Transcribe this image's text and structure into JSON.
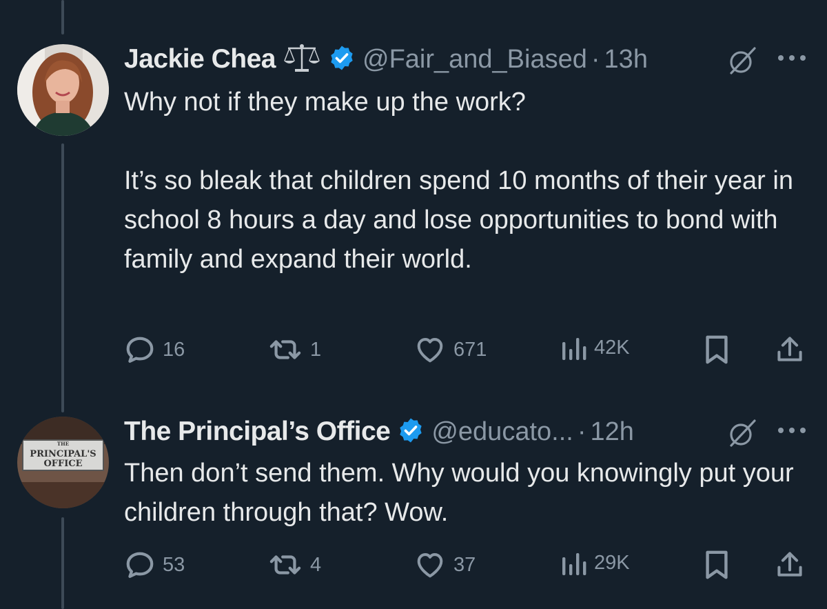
{
  "tweets": [
    {
      "display_name": "Jackie Chea",
      "handle": "@Fair_and_Biased",
      "separator": "·",
      "time": "13h",
      "text": "Why not if they make up the work?\n\nIt’s so bleak that children spend 10 months of their year in school 8 hours a day and lose opportunities to bond with family and expand their world.",
      "replies": "16",
      "reposts": "1",
      "likes": "671",
      "views": "42K",
      "icons": [
        "scale-icon",
        "verified-icon",
        "grok-icon",
        "more-icon"
      ]
    },
    {
      "display_name": "The Principal’s Office",
      "handle": "@educato...",
      "separator": "·",
      "time": "12h",
      "text": "Then don’t send them. Why would you knowingly put your children through that? Wow.",
      "replies": "53",
      "reposts": "4",
      "likes": "37",
      "views": "29K",
      "avatar_sign_small": "THE",
      "avatar_sign_main": "PRINCIPAL'S",
      "avatar_sign_sub": "OFFICE"
    }
  ],
  "colors": {
    "background": "#15202b",
    "text": "#e7e9ea",
    "muted": "#8b98a5",
    "verified": "#1d9bf0"
  }
}
